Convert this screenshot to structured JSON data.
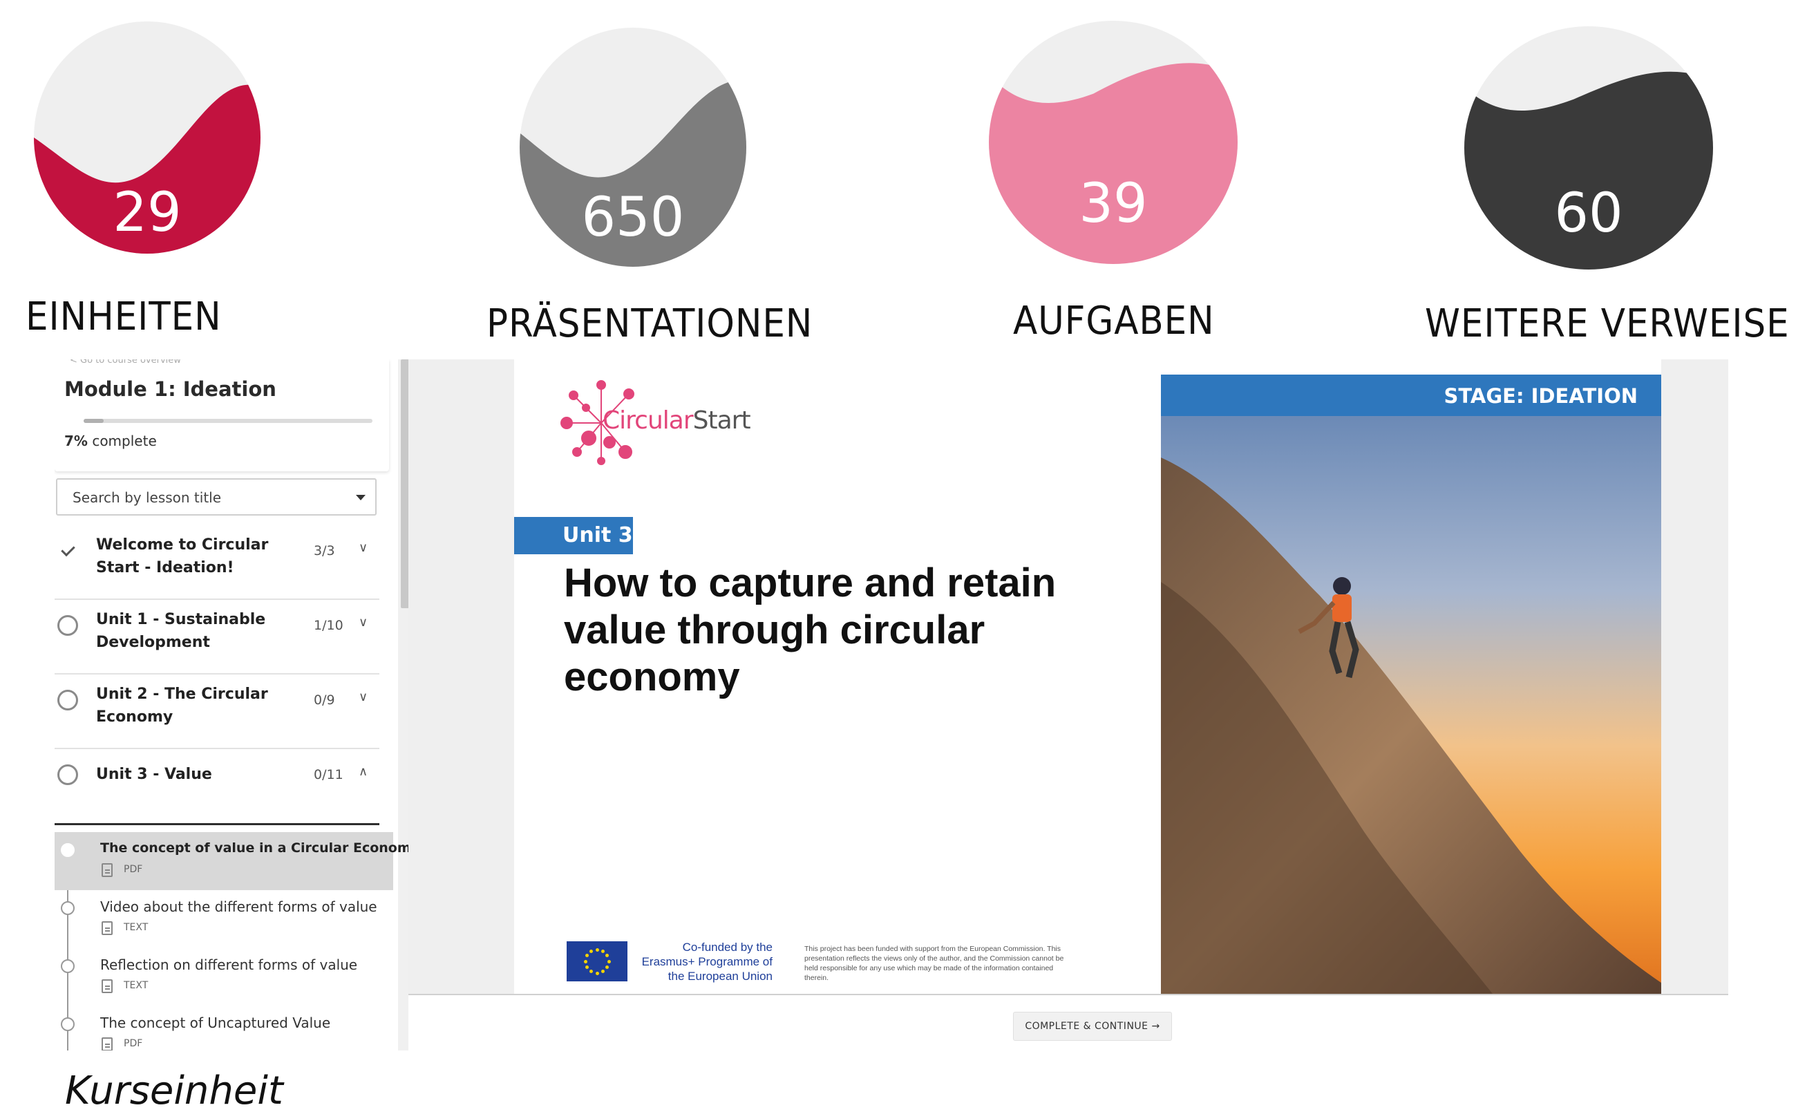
{
  "stats": [
    {
      "number": "29",
      "label": "EINHEITEN",
      "color": "#c2123f"
    },
    {
      "number": "650",
      "label": "PRÄSENTATIONEN",
      "color": "#7d7d7d"
    },
    {
      "number": "39",
      "label": "AUFGABEN",
      "color": "#ec84a2"
    },
    {
      "number": "60",
      "label": "WEITERE VERWEISE",
      "color": "#3a3a3a"
    }
  ],
  "sidebar": {
    "back_link": "< Go to course overview",
    "module_title": "Module 1: Ideation",
    "progress_percent": 7,
    "progress_value": "7%",
    "progress_suffix": "complete",
    "search_placeholder": "Search by lesson title",
    "units": [
      {
        "title": "Welcome to Circular Start - Ideation!",
        "count": "3/3",
        "status": "done"
      },
      {
        "title": "Unit 1 - Sustainable Development",
        "count": "1/10",
        "status": "open"
      },
      {
        "title": "Unit 2 - The Circular Economy",
        "count": "0/9",
        "status": "open"
      },
      {
        "title": "Unit 3 - Value",
        "count": "0/11",
        "status": "expanded"
      }
    ],
    "lessons": [
      {
        "title": "The concept of value in a Circular Economy",
        "type": "PDF"
      },
      {
        "title": "Video about the different forms of value",
        "type": "TEXT"
      },
      {
        "title": "Reflection on different forms of value",
        "type": "TEXT"
      },
      {
        "title": "The concept of Uncaptured Value",
        "type": "PDF"
      }
    ]
  },
  "slide": {
    "logo": "CircularStart",
    "unit_badge": "Unit 3",
    "heading": "How to capture and retain value through circular economy",
    "stage_banner": "STAGE: IDEATION",
    "eu_text": "Co-funded by the Erasmus+ Programme of the European Union",
    "disclaimer": "This project has been funded with support from the European Commission. This presentation reflects the views only of the author, and the Commission cannot be held responsible for any use which may be made of the information contained therein."
  },
  "complete_button": "COMPLETE & CONTINUE →",
  "caption": "Kurseinheit",
  "colors": {
    "accent_blue": "#2e77bd",
    "brand_pink": "#e2457a"
  }
}
